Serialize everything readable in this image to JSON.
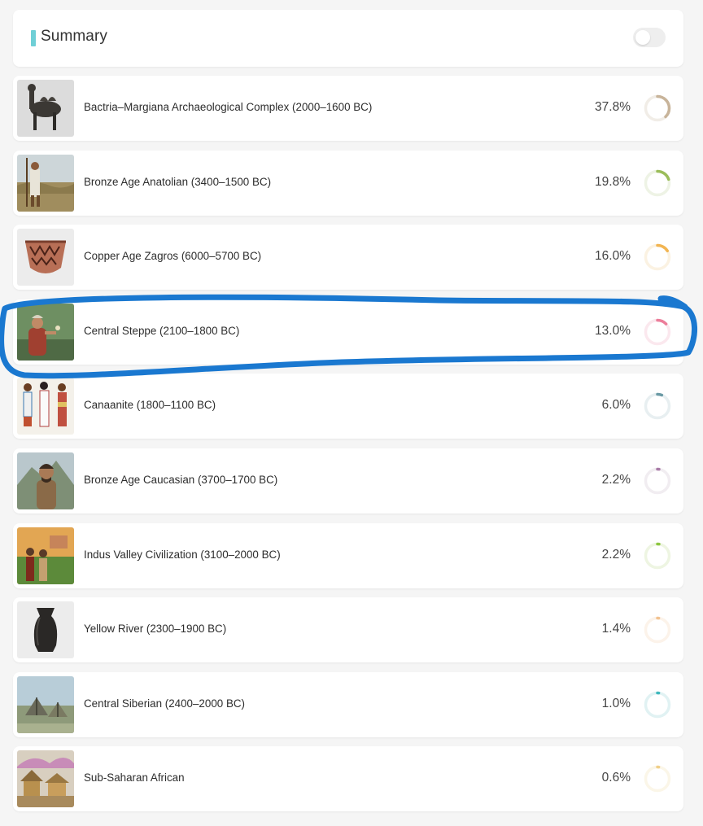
{
  "summary": {
    "title": "Summary",
    "accent_color": "#6fcfd6",
    "toggle_on": false
  },
  "populations": [
    {
      "label": "Bactria–Margiana Archaeological Complex (2000–1600 BC)",
      "percent_text": "37.8%",
      "value": 37.8,
      "color": "#c8b49a",
      "track": "#f1ede7",
      "thumb": "camel-figurine"
    },
    {
      "label": "Bronze Age Anatolian (3400–1500 BC)",
      "percent_text": "19.8%",
      "value": 19.8,
      "color": "#9bbd5a",
      "track": "#eef3e5",
      "thumb": "anatolian-man"
    },
    {
      "label": "Copper Age Zagros (6000–5700 BC)",
      "percent_text": "16.0%",
      "value": 16.0,
      "color": "#f2b552",
      "track": "#fbf2e2",
      "thumb": "painted-pottery"
    },
    {
      "label": "Central Steppe (2100–1800 BC)",
      "percent_text": "13.0%",
      "value": 13.0,
      "color": "#ec7d9a",
      "track": "#fbe8ee",
      "thumb": "steppe-woman"
    },
    {
      "label": "Canaanite (1800–1100 BC)",
      "percent_text": "6.0%",
      "value": 6.0,
      "color": "#6b9aa5",
      "track": "#e8eff1",
      "thumb": "canaanite-people"
    },
    {
      "label": "Bronze Age Caucasian (3700–1700 BC)",
      "percent_text": "2.2%",
      "value": 2.2,
      "color": "#a97ba7",
      "track": "#f1edf1",
      "thumb": "caucasian-man"
    },
    {
      "label": "Indus Valley Civilization (3100–2000 BC)",
      "percent_text": "2.2%",
      "value": 2.2,
      "color": "#8cc63f",
      "track": "#eef5e2",
      "thumb": "indus-couple"
    },
    {
      "label": "Yellow River (2300–1900 BC)",
      "percent_text": "1.4%",
      "value": 1.4,
      "color": "#f2c290",
      "track": "#fcf3ea",
      "thumb": "black-vessel"
    },
    {
      "label": "Central Siberian (2400–2000 BC)",
      "percent_text": "1.0%",
      "value": 1.0,
      "color": "#3fb8bd",
      "track": "#e1f2f3",
      "thumb": "siberian-camp"
    },
    {
      "label": "Sub-Saharan African",
      "percent_text": "0.6%",
      "value": 0.6,
      "color": "#f0cf88",
      "track": "#fbf6e8",
      "thumb": "african-village"
    }
  ],
  "annotation": {
    "color": "#1a78d0",
    "highlighted_index": 3
  }
}
